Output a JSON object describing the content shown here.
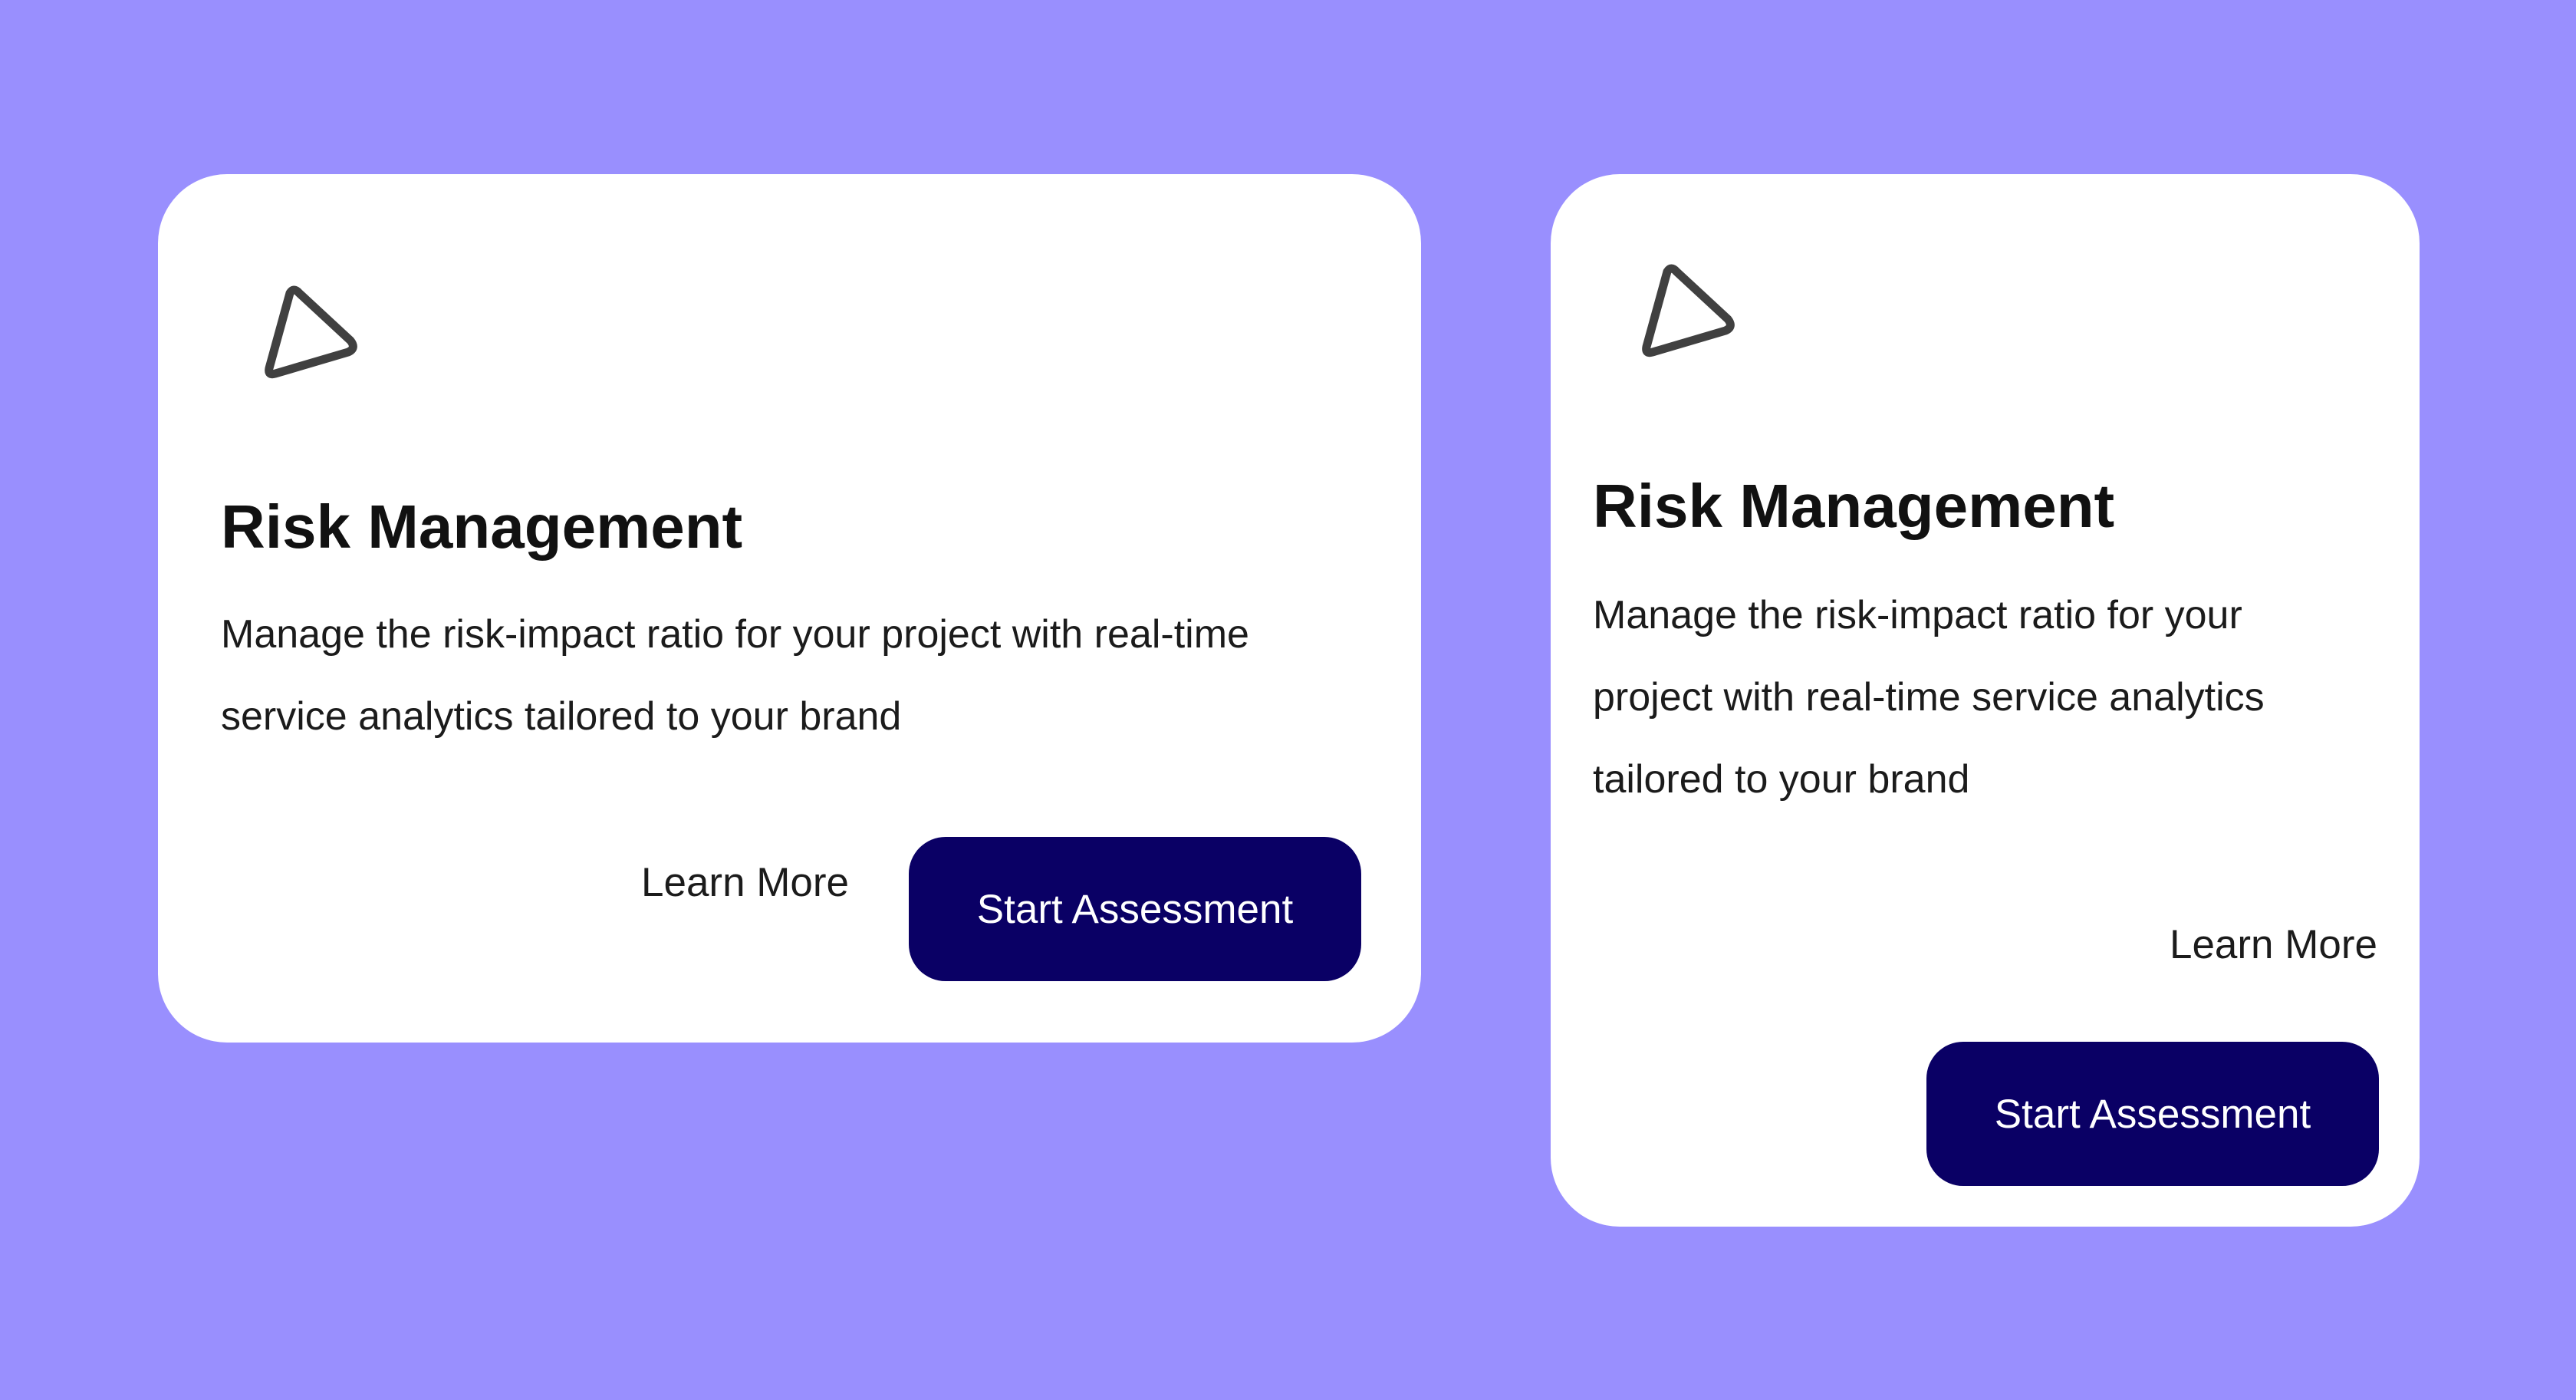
{
  "cards": [
    {
      "icon": "triangle-play-icon",
      "title": "Risk Management",
      "description": "Manage the risk-impact ratio for your project with real-time service analytics tailored to your brand",
      "learn_more_label": "Learn More",
      "start_label": "Start Assessment"
    },
    {
      "icon": "triangle-play-icon",
      "title": "Risk Management",
      "description": "Manage the risk-impact ratio for your project with real-time service analytics tailored to your brand",
      "learn_more_label": "Learn More",
      "start_label": "Start Assessment"
    }
  ],
  "colors": {
    "background": "#998ffe",
    "card": "#ffffff",
    "button": "#0a0065",
    "button_text": "#ffffff",
    "icon_stroke": "#404040"
  }
}
